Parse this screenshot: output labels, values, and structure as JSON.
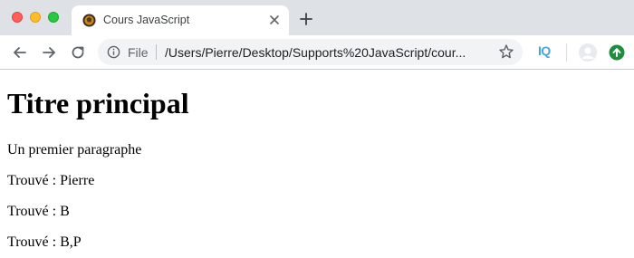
{
  "browser": {
    "tab": {
      "title": "Cours JavaScript",
      "favicon": "javascript-course-favicon"
    },
    "omnibox": {
      "scheme_label": "File",
      "url": "/Users/Pierre/Desktop/Supports%20JavaScript/cour..."
    },
    "extension_label": "IQ",
    "icons": [
      "back-icon",
      "forward-icon",
      "reload-icon",
      "info-icon",
      "star-icon",
      "close-icon",
      "new-tab-icon",
      "avatar",
      "update-icon"
    ],
    "colors": {
      "tabstrip": "#dee1e6",
      "omnibox": "#f1f3f4",
      "extension": "#4ba3d8",
      "update": "#1e8e3e"
    }
  },
  "page": {
    "heading": "Titre principal",
    "paragraphs": [
      "Un premier paragraphe",
      "Trouvé : Pierre",
      "Trouvé : B",
      "Trouvé : B,P"
    ]
  }
}
